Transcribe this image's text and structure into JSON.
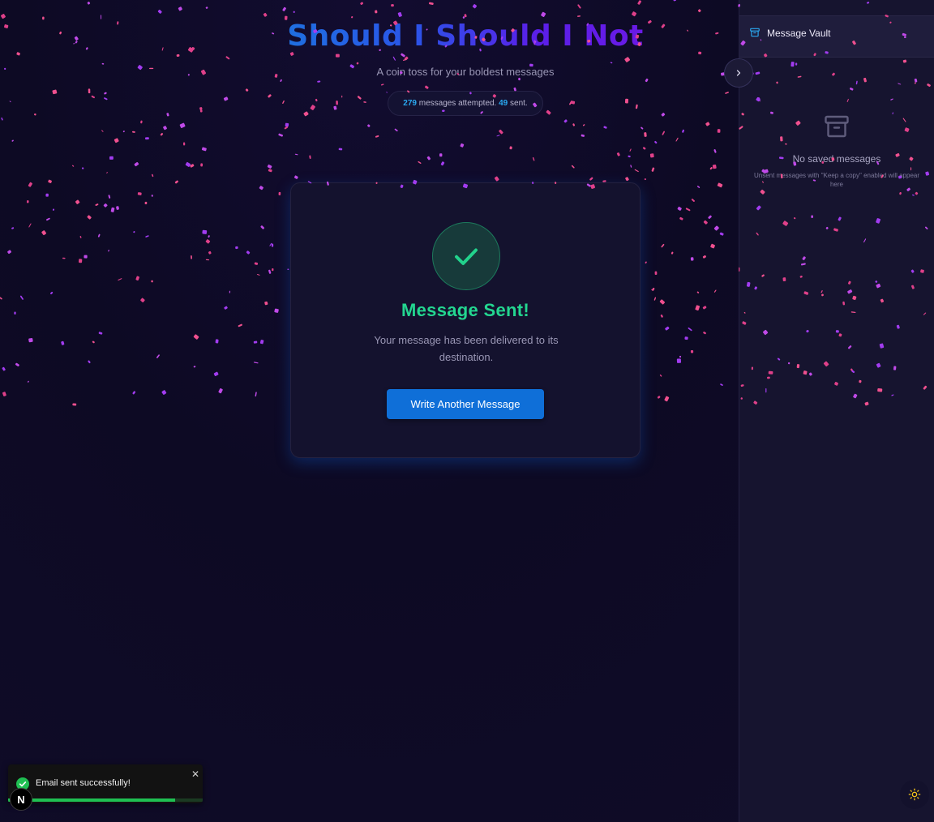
{
  "header": {
    "title": "Should I Should I Not",
    "subtitle": "A coin toss for your boldest messages",
    "stats": {
      "attempted": "279",
      "attempted_label": "messages attempted.",
      "sent": "49",
      "sent_label": "sent."
    }
  },
  "card": {
    "icon": "check-icon",
    "title": "Message Sent!",
    "text": "Your message has been delivered to its destination.",
    "button_label": "Write Another Message"
  },
  "sidebar": {
    "title": "Message Vault",
    "icon": "archive-icon",
    "collapse_icon": "chevron-right-icon",
    "empty_title": "No saved messages",
    "empty_subtitle": "Unsent messages with \"Keep a copy\" enabled will appear here",
    "theme_icon": "sun-icon"
  },
  "toast": {
    "message": "Email sent successfully!",
    "close_label": "✕",
    "progress": 0.86
  },
  "dev_badge": "N",
  "colors": {
    "accent": "#0f6fd8",
    "success": "#23d690",
    "confetti_pink": "#f0508f",
    "confetti_purple": "#a23cf0"
  }
}
